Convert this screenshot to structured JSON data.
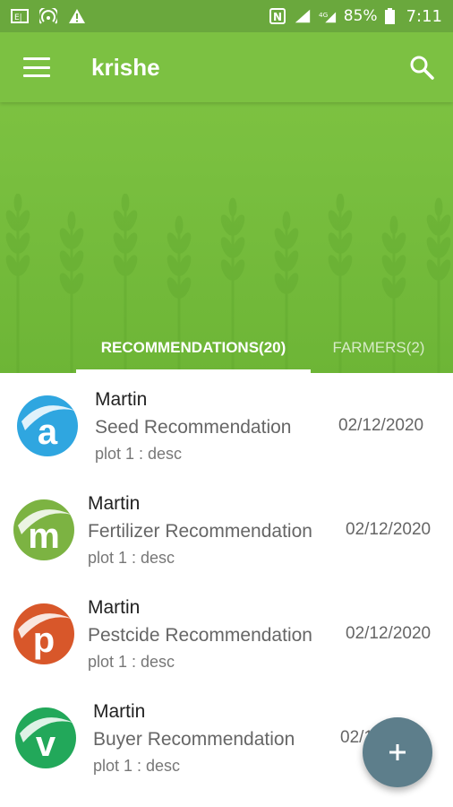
{
  "status_bar": {
    "battery": "85%",
    "time": "7:11",
    "icons": [
      "sim-icon",
      "hotspot-icon",
      "warning-icon",
      "nfc-icon",
      "signal-icon",
      "data-icon",
      "battery-icon"
    ]
  },
  "toolbar": {
    "title": "krishe",
    "menu_icon": "hamburger-menu-icon",
    "search_icon": "search-icon"
  },
  "tabs": [
    {
      "label": "RECOMMENDATIONS(20)",
      "active": true
    },
    {
      "label": "FARMERS(2)",
      "active": false
    }
  ],
  "recommendations": [
    {
      "name": "Martin",
      "type": "Seed Recommendation",
      "desc": "plot 1 : desc",
      "date": "02/12/2020",
      "avatar_letter": "a",
      "avatar_color": "#2fa6e0"
    },
    {
      "name": "Martin",
      "type": "Fertilizer Recommendation",
      "desc": "plot 1 : desc",
      "date": "02/12/2020",
      "avatar_letter": "m",
      "avatar_color": "#7cb342"
    },
    {
      "name": "Martin",
      "type": "Pestcide Recommendation",
      "desc": "plot 1 : desc",
      "date": "02/12/2020",
      "avatar_letter": "p",
      "avatar_color": "#d8572a"
    },
    {
      "name": "Martin",
      "type": "Buyer Recommendation",
      "desc": "plot 1 : desc",
      "date": "02/12/2020",
      "avatar_letter": "v",
      "avatar_color": "#22a85a"
    }
  ],
  "fab": {
    "label": "+",
    "icon": "add-icon"
  },
  "colors": {
    "primary": "#7cc142",
    "status_bar": "#6aa83d",
    "fab": "#5d7e8b"
  }
}
